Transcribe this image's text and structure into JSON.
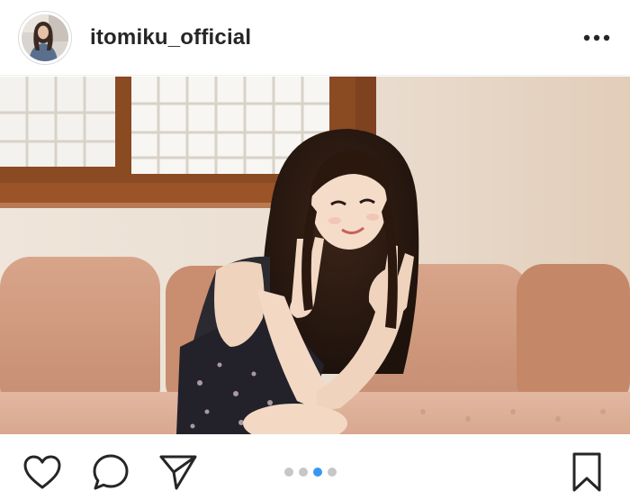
{
  "header": {
    "username": "itomiku_official",
    "avatar_icon": "profile-avatar",
    "more_icon": "more-dots-icon"
  },
  "photo": {
    "icon": "post-photo"
  },
  "actions": {
    "like_icon": "heart-icon",
    "comment_icon": "comment-icon",
    "share_icon": "paper-plane-icon",
    "save_icon": "bookmark-icon"
  },
  "carousel": {
    "count": 4,
    "active_index": 2,
    "active_color": "#3897f0",
    "inactive_color": "#c7c7c7"
  }
}
